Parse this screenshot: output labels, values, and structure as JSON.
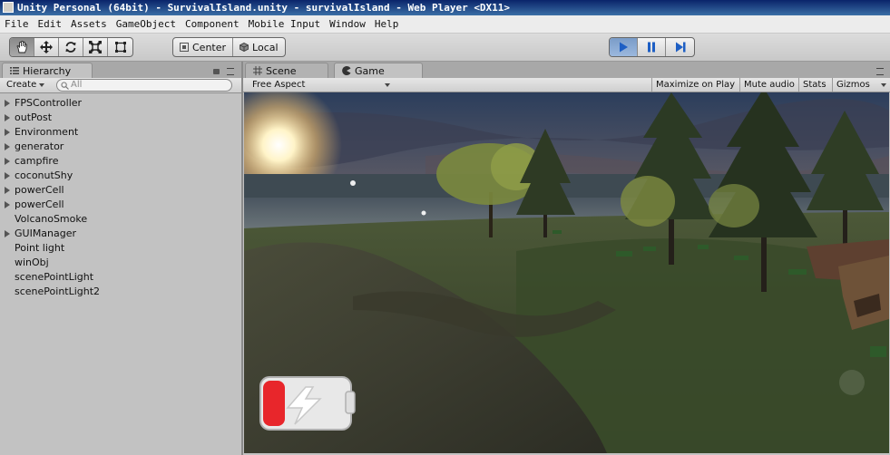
{
  "window": {
    "title": "Unity Personal (64bit) - SurvivalIsland.unity - survivalIsland - Web Player <DX11>"
  },
  "menu": {
    "items": [
      "File",
      "Edit",
      "Assets",
      "GameObject",
      "Component",
      "Mobile Input",
      "Window",
      "Help"
    ]
  },
  "toolbar": {
    "tools": [
      "hand-icon",
      "move-icon",
      "rotate-icon",
      "scale-icon",
      "rect-icon"
    ],
    "pivot_label": "Center",
    "space_label": "Local",
    "play_controls": [
      "play-icon",
      "pause-icon",
      "step-icon"
    ]
  },
  "hierarchy": {
    "tab_label": "Hierarchy",
    "create_label": "Create",
    "search_placeholder": "All",
    "items": [
      {
        "label": "FPSController",
        "expandable": true
      },
      {
        "label": "outPost",
        "expandable": true
      },
      {
        "label": "Environment",
        "expandable": true
      },
      {
        "label": "generator",
        "expandable": true
      },
      {
        "label": "campfire",
        "expandable": true
      },
      {
        "label": "coconutShy",
        "expandable": true
      },
      {
        "label": "powerCell",
        "expandable": true
      },
      {
        "label": "powerCell",
        "expandable": true
      },
      {
        "label": "VolcanoSmoke",
        "expandable": false
      },
      {
        "label": "GUIManager",
        "expandable": true
      },
      {
        "label": "Point light",
        "expandable": false
      },
      {
        "label": "winObj",
        "expandable": false
      },
      {
        "label": "scenePointLight",
        "expandable": false
      },
      {
        "label": "scenePointLight2",
        "expandable": false
      }
    ]
  },
  "game_panel": {
    "tabs": [
      "Scene",
      "Game"
    ],
    "active_tab": "Game",
    "aspect_label": "Free Aspect",
    "buttons": [
      "Maximize on Play",
      "Mute audio",
      "Stats",
      "Gizmos"
    ]
  },
  "colors": {
    "play_active": "#3b73c8",
    "battery_red": "#e8262b"
  }
}
